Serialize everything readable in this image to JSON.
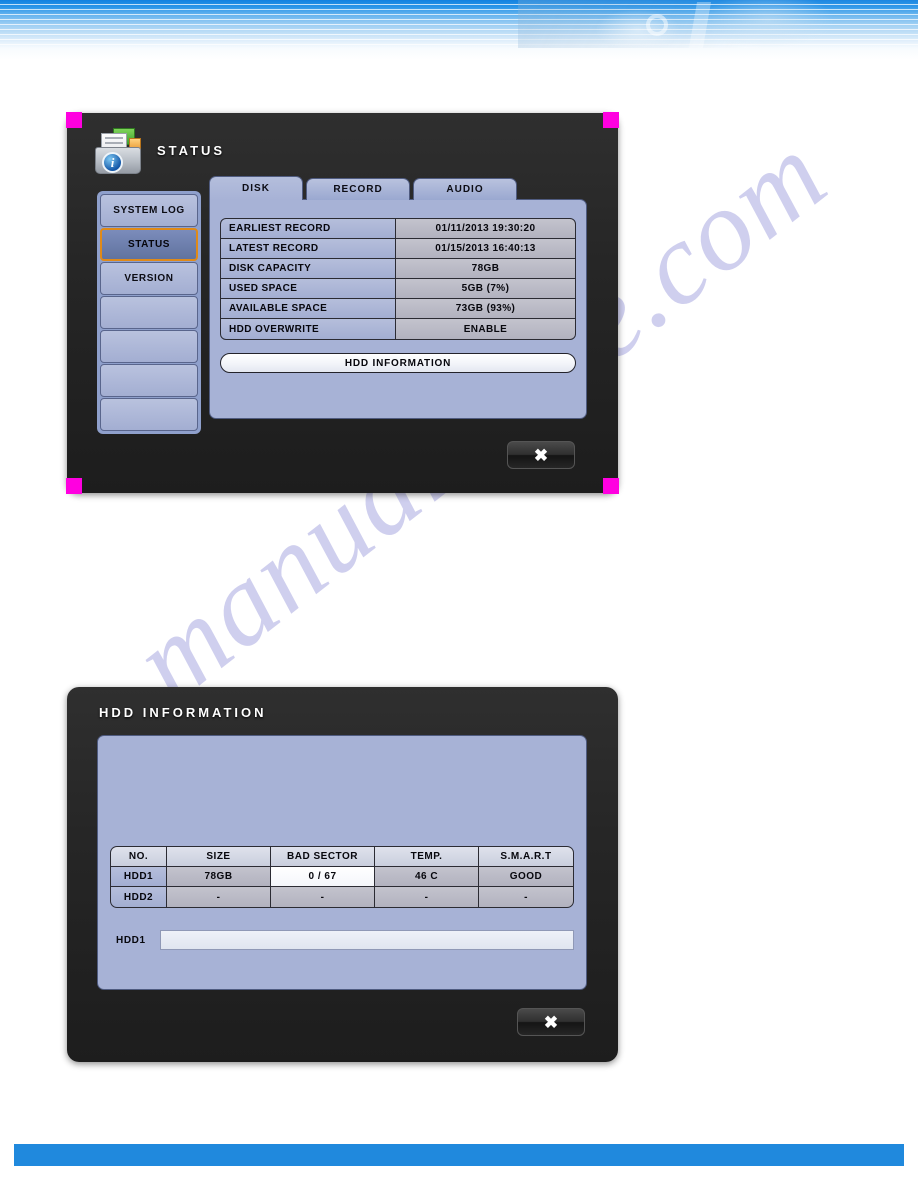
{
  "page": {
    "watermark": "manualshive.com"
  },
  "status_dialog": {
    "title": "STATUS",
    "icon": "status-document-info-icon",
    "info_badge": "i",
    "sidebar": [
      {
        "label": "SYSTEM LOG",
        "selected": false
      },
      {
        "label": "STATUS",
        "selected": true
      },
      {
        "label": "VERSION",
        "selected": false
      },
      {
        "label": "",
        "selected": false
      },
      {
        "label": "",
        "selected": false
      },
      {
        "label": "",
        "selected": false
      },
      {
        "label": "",
        "selected": false
      }
    ],
    "tabs": [
      {
        "label": "DISK",
        "active": true
      },
      {
        "label": "RECORD",
        "active": false
      },
      {
        "label": "AUDIO",
        "active": false
      }
    ],
    "rows": [
      {
        "label": "EARLIEST RECORD",
        "value": "01/11/2013 19:30:20"
      },
      {
        "label": "LATEST RECORD",
        "value": "01/15/2013 16:40:13"
      },
      {
        "label": "DISK CAPACITY",
        "value": "78GB"
      },
      {
        "label": "USED SPACE",
        "value": "5GB (7%)"
      },
      {
        "label": "AVAILABLE SPACE",
        "value": "73GB (93%)"
      },
      {
        "label": "HDD OVERWRITE",
        "value": "ENABLE"
      }
    ],
    "hdd_information_button": "HDD INFORMATION",
    "close_label": "✖"
  },
  "hdd_dialog": {
    "title": "HDD INFORMATION",
    "columns": [
      "NO.",
      "SIZE",
      "BAD SECTOR",
      "TEMP.",
      "S.M.A.R.T"
    ],
    "rows": [
      {
        "no": "HDD1",
        "size": "78GB",
        "bad_sector": "0 / 67",
        "temp": "46 C",
        "smart": "GOOD",
        "bad_sector_highlight": true
      },
      {
        "no": "HDD2",
        "size": "-",
        "bad_sector": "-",
        "temp": "-",
        "smart": "-",
        "bad_sector_highlight": false
      }
    ],
    "detail": {
      "label": "HDD1",
      "value": ""
    },
    "close_label": "✖"
  },
  "colors": {
    "panel_blue": "#a7b2d6",
    "label_blue": "#a3aed2",
    "value_gray": "#b2b2bf",
    "selected_border": "#e08a18",
    "banner_blue": "#1382e0",
    "footer_blue": "#2089dd",
    "corner_marker": "#ff00e0"
  }
}
